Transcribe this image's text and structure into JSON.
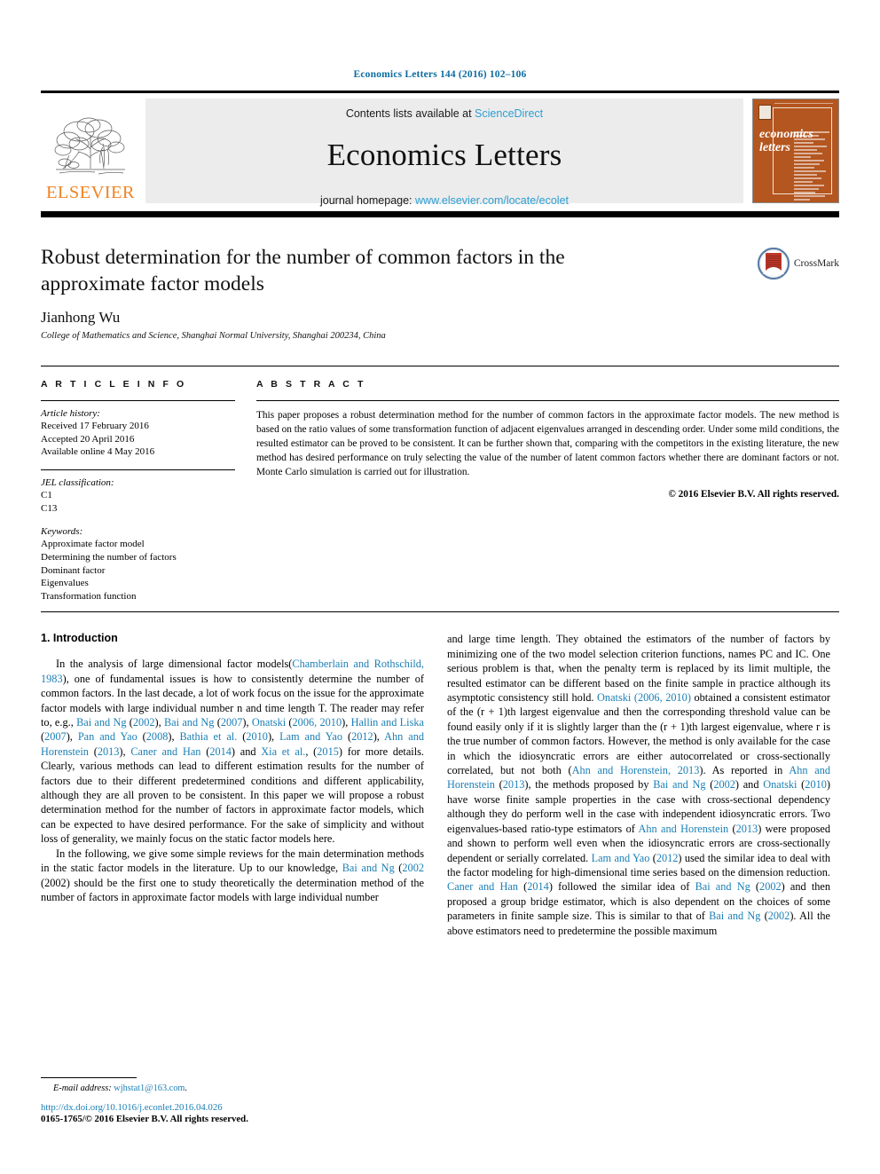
{
  "running_head": "Economics Letters 144 (2016) 102–106",
  "masthead": {
    "contents_prefix": "Contents lists available at ",
    "sciencedirect": "ScienceDirect",
    "journal_name": "Economics Letters",
    "homepage_prefix": "journal homepage: ",
    "homepage_url": "www.elsevier.com/locate/ecolet",
    "publisher_logo_text": "ELSEVIER",
    "cover_title_line1": "economics",
    "cover_title_line2": "letters",
    "accent_orange": "#f08422",
    "link_blue": "#2e9fd4",
    "cover_brown": "#b4561f"
  },
  "article": {
    "title": "Robust determination for the number of common factors in the approximate factor models",
    "author": "Jianhong Wu",
    "affiliation": "College of Mathematics and Science, Shanghai Normal University, Shanghai 200234, China",
    "crossmark_label": "CrossMark"
  },
  "info": {
    "heading": "A R T I C L E    I N F O",
    "history_label": "Article history:",
    "history": [
      "Received 17 February 2016",
      "Accepted 20 April 2016",
      "Available online 4 May 2016"
    ],
    "jel_label": "JEL classification:",
    "jel": [
      "C1",
      "C13"
    ],
    "keywords_label": "Keywords:",
    "keywords": [
      "Approximate factor model",
      "Determining the number of factors",
      "Dominant factor",
      "Eigenvalues",
      "Transformation function"
    ]
  },
  "abstract": {
    "heading": "A B S T R A C T",
    "text": "This paper proposes a robust determination method for the number of common factors in the approximate factor models. The new method is based on the ratio values of some transformation function of adjacent eigenvalues arranged in descending order. Under some mild conditions, the resulted estimator can be proved to be consistent. It can be further shown that, comparing with the competitors in the existing literature, the new method has desired performance on truly selecting the value of the number of latent common factors whether there are dominant factors or not. Monte Carlo simulation is carried out for illustration.",
    "copyright": "© 2016 Elsevier B.V. All rights reserved."
  },
  "intro": {
    "section_title": "1. Introduction",
    "left_para1_a": "In the analysis of large dimensional factor models(",
    "left_ref1": "Chamberlain and Rothschild, 1983",
    "left_para1_b": "), one of fundamental issues is how to consistently determine the number of common factors. In the last decade, a lot of work focus on the issue for the approximate factor models with large individual number n and time length T. The reader may refer to, e.g., ",
    "refs_list": [
      "Bai and Ng",
      "Bai and Ng",
      "Onatski",
      "Hallin and Liska",
      "Pan and Yao",
      "Bathia et al.",
      "Lam and Yao",
      "Ahn and Horenstein",
      "Caner and Han",
      "Xia et al."
    ],
    "left_para1_c": "(2002), ",
    "left_para1_tail": ") for more details. Clearly, various methods can lead to different estimation results for the number of factors due to their different predetermined conditions and different applicability, although they are all proven to be consistent. In this paper we will propose a robust determination method for the number of factors in approximate factor models, which can be expected to have desired performance. For the sake of simplicity and without loss of generality, we mainly focus on the static factor models here.",
    "left_para2_a": "In the following, we give some simple reviews for the main determination methods in the static factor models in the literature. Up to our knowledge, ",
    "left_para2_ref": "Bai and Ng",
    "left_para2_b": " (2002) should be the first one to study theoretically the determination method of the number of factors in approximate factor models with large individual number",
    "right_para_a": "and large time length. They obtained the estimators of the number of factors by minimizing one of the two model selection criterion functions, names PC and IC. One serious problem is that, when the penalty term is replaced by its limit multiple, the resulted estimator can be different based on the finite sample in practice although its asymptotic consistency still hold. ",
    "right_ref_onatski": "Onatski (2006, 2010)",
    "right_para_b": " obtained a consistent estimator of the (r + 1)th largest eigenvalue and then the corresponding threshold value can be found easily only if it is slightly larger than the (r + 1)th largest eigenvalue, where r is the true number of common factors. However, the method is only available for the case in which the idiosyncratic errors are either autocorrelated or cross-sectionally correlated, but not both ("
  },
  "footnote": {
    "email_label": "E-mail address:",
    "email": "wjhstat1@163.com",
    "email_suffix": ".",
    "doi": "http://dx.doi.org/10.1016/j.econlet.2016.04.026",
    "issn": "0165-1765/© 2016 Elsevier B.V. All rights reserved."
  }
}
